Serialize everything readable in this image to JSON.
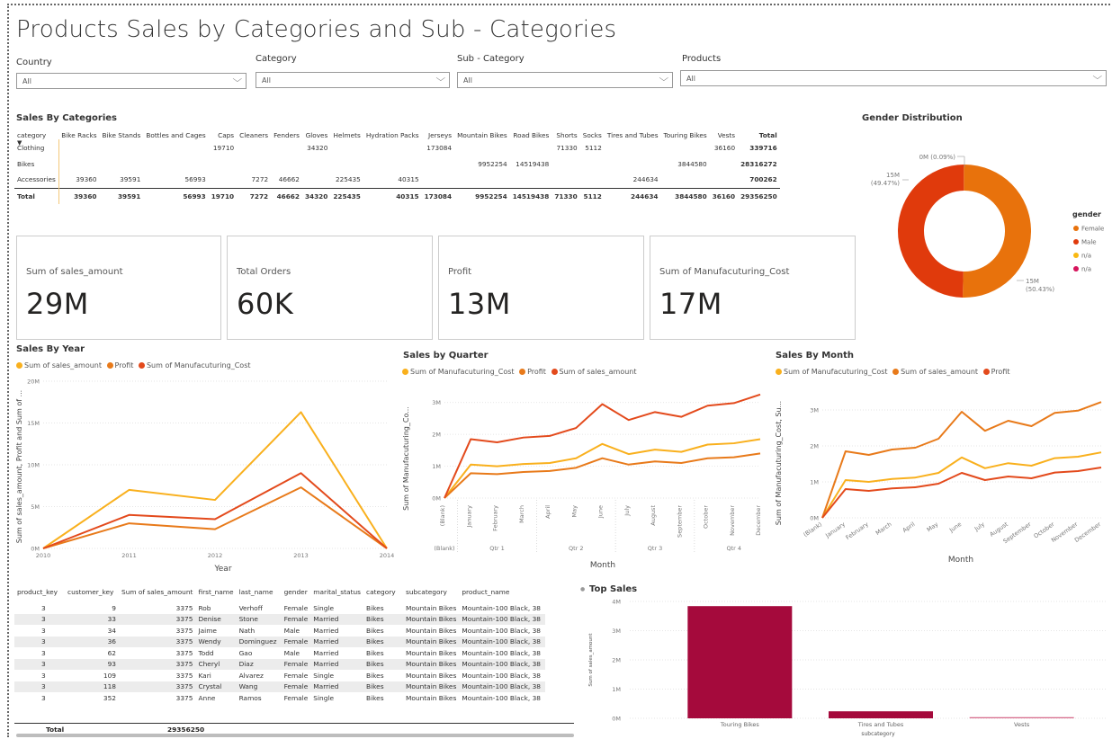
{
  "report_title": "Products Sales by Categories and Sub - Categories",
  "slicers": [
    {
      "label": "Country",
      "value": "All"
    },
    {
      "label": "Category",
      "value": "All"
    },
    {
      "label": "Sub - Category",
      "value": "All"
    },
    {
      "label": "Products",
      "value": "All"
    }
  ],
  "matrix": {
    "title": "Sales By Categories",
    "columns": [
      "category",
      "Bike Racks",
      "Bike Stands",
      "Bottles and Cages",
      "Caps",
      "Cleaners",
      "Fenders",
      "Gloves",
      "Helmets",
      "Hydration Packs",
      "Jerseys",
      "Mountain Bikes",
      "Road Bikes",
      "Shorts",
      "Socks",
      "Tires and Tubes",
      "Touring Bikes",
      "Vests",
      "Total"
    ],
    "rows": [
      [
        "Clothing",
        "",
        "",
        "",
        "19710",
        "",
        "",
        "34320",
        "",
        "",
        "173084",
        "",
        "",
        "71330",
        "5112",
        "",
        "",
        "36160",
        "339716"
      ],
      [
        "Bikes",
        "",
        "",
        "",
        "",
        "",
        "",
        "",
        "",
        "",
        "",
        "9952254",
        "14519438",
        "",
        "",
        "",
        "3844580",
        "",
        "28316272"
      ],
      [
        "Accessories",
        "39360",
        "39591",
        "56993",
        "",
        "7272",
        "46662",
        "",
        "225435",
        "40315",
        "",
        "",
        "",
        "",
        "",
        "244634",
        "",
        "",
        "700262"
      ]
    ],
    "total": [
      "Total",
      "39360",
      "39591",
      "56993",
      "19710",
      "7272",
      "46662",
      "34320",
      "225435",
      "40315",
      "173084",
      "9952254",
      "14519438",
      "71330",
      "5112",
      "244634",
      "3844580",
      "36160",
      "29356250"
    ]
  },
  "kpis": [
    {
      "label": "Sum of sales_amount",
      "value": "29M"
    },
    {
      "label": "Total Orders",
      "value": "60K"
    },
    {
      "label": "Profit",
      "value": "13M"
    },
    {
      "label": "Sum of Manufacuturing_Cost",
      "value": "17M"
    }
  ],
  "gender_chart": {
    "title": "Gender Distribution",
    "legend_title": "gender",
    "outer_labels": {
      "top": "0M (0.09%)",
      "left_value": "15M",
      "left_pct": "(49.47%)",
      "right_value": "15M",
      "right_pct": "(50.43%)"
    },
    "chart_data": {
      "type": "pie",
      "categories": [
        "Female",
        "Male",
        "n/a",
        "n/a"
      ],
      "values": [
        50.43,
        49.47,
        0.09,
        0.01
      ],
      "colors": [
        "#E8720C",
        "#E03A0C",
        "#F9B912",
        "#D6145C"
      ]
    }
  },
  "sales_by_year": {
    "title": "Sales By Year",
    "legend": [
      {
        "name": "Sum of sales_amount",
        "color": "#F9B01D"
      },
      {
        "name": "Profit",
        "color": "#E87A1A"
      },
      {
        "name": "Sum of Manufacuturing_Cost",
        "color": "#E34A1C"
      }
    ],
    "ylabel": "Sum of sales_amount, Profit and Sum of ...",
    "xlabel": "Year",
    "yticks": [
      "0M",
      "5M",
      "10M",
      "15M",
      "20M"
    ],
    "chart_data": {
      "type": "line",
      "x": [
        "2010",
        "2011",
        "2012",
        "2013",
        "2014"
      ],
      "ylim": [
        0,
        20
      ],
      "series": [
        {
          "name": "Sum of sales_amount",
          "values": [
            0,
            7.0,
            5.8,
            16.3,
            0
          ]
        },
        {
          "name": "Profit",
          "values": [
            0,
            3.0,
            2.3,
            7.3,
            0
          ]
        },
        {
          "name": "Sum of Manufacuturing_Cost",
          "values": [
            0,
            4.0,
            3.5,
            9.0,
            0
          ]
        }
      ]
    }
  },
  "sales_by_quarter": {
    "title": "Sales by Quarter",
    "legend": [
      {
        "name": "Sum of Manufacuturing_Cost",
        "color": "#F9B01D"
      },
      {
        "name": "Profit",
        "color": "#E87A1A"
      },
      {
        "name": "Sum of sales_amount",
        "color": "#E34A1C"
      }
    ],
    "ylabel": "Sum of Manufacuturing_Co...",
    "xlabel": "Month",
    "yticks": [
      "0M",
      "1M",
      "2M",
      "3M"
    ],
    "groups": [
      "(Blank)",
      "Qtr 1",
      "Qtr 2",
      "Qtr 3",
      "Qtr 4"
    ],
    "chart_data": {
      "type": "line",
      "x": [
        "(Blank)",
        "January",
        "February",
        "March",
        "April",
        "May",
        "June",
        "July",
        "August",
        "September",
        "October",
        "November",
        "December"
      ],
      "ylim": [
        0,
        3.5
      ],
      "series": [
        {
          "name": "Sum of Manufacuturing_Cost",
          "values": [
            0,
            1.05,
            1.0,
            1.07,
            1.1,
            1.25,
            1.7,
            1.38,
            1.52,
            1.45,
            1.68,
            1.72,
            1.85
          ]
        },
        {
          "name": "Profit",
          "values": [
            0,
            0.78,
            0.75,
            0.82,
            0.85,
            0.95,
            1.25,
            1.05,
            1.15,
            1.1,
            1.25,
            1.28,
            1.4
          ]
        },
        {
          "name": "Sum of sales_amount",
          "values": [
            0,
            1.85,
            1.75,
            1.9,
            1.95,
            2.2,
            2.95,
            2.45,
            2.7,
            2.55,
            2.9,
            2.98,
            3.25
          ]
        }
      ]
    }
  },
  "sales_by_month": {
    "title": "Sales By Month",
    "legend": [
      {
        "name": "Sum of Manufacuturing_Cost",
        "color": "#F9B01D"
      },
      {
        "name": "Sum of sales_amount",
        "color": "#E87A1A"
      },
      {
        "name": "Profit",
        "color": "#E34A1C"
      }
    ],
    "ylabel": "Sum of Manufacuturing_Cost, Su...",
    "xlabel": "Month",
    "yticks": [
      "0M",
      "1M",
      "2M",
      "3M"
    ],
    "chart_data": {
      "type": "line",
      "x": [
        "(Blank)",
        "January",
        "February",
        "March",
        "April",
        "May",
        "June",
        "July",
        "August",
        "September",
        "October",
        "November",
        "December"
      ],
      "ylim": [
        0,
        3.5
      ],
      "series": [
        {
          "name": "Sum of Manufacuturing_Cost",
          "values": [
            0,
            1.05,
            1.0,
            1.08,
            1.12,
            1.25,
            1.68,
            1.38,
            1.52,
            1.45,
            1.66,
            1.7,
            1.82
          ]
        },
        {
          "name": "Sum of sales_amount",
          "values": [
            0,
            1.85,
            1.75,
            1.9,
            1.95,
            2.2,
            2.95,
            2.42,
            2.7,
            2.55,
            2.92,
            2.98,
            3.22
          ]
        },
        {
          "name": "Profit",
          "values": [
            0,
            0.8,
            0.75,
            0.82,
            0.85,
            0.95,
            1.25,
            1.05,
            1.15,
            1.1,
            1.26,
            1.3,
            1.4
          ]
        }
      ]
    }
  },
  "detail_table": {
    "columns": [
      "product_key",
      "customer_key",
      "Sum of sales_amount",
      "first_name",
      "last_name",
      "gender",
      "marital_status",
      "category",
      "subcategory",
      "product_name"
    ],
    "rows": [
      [
        "3",
        "9",
        "3375",
        "Rob",
        "Verhoff",
        "Female",
        "Single",
        "Bikes",
        "Mountain Bikes",
        "Mountain-100 Black, 38"
      ],
      [
        "3",
        "33",
        "3375",
        "Denise",
        "Stone",
        "Female",
        "Married",
        "Bikes",
        "Mountain Bikes",
        "Mountain-100 Black, 38"
      ],
      [
        "3",
        "34",
        "3375",
        "Jaime",
        "Nath",
        "Male",
        "Married",
        "Bikes",
        "Mountain Bikes",
        "Mountain-100 Black, 38"
      ],
      [
        "3",
        "36",
        "3375",
        "Wendy",
        "Dominguez",
        "Female",
        "Married",
        "Bikes",
        "Mountain Bikes",
        "Mountain-100 Black, 38"
      ],
      [
        "3",
        "62",
        "3375",
        "Todd",
        "Gao",
        "Male",
        "Married",
        "Bikes",
        "Mountain Bikes",
        "Mountain-100 Black, 38"
      ],
      [
        "3",
        "93",
        "3375",
        "Cheryl",
        "Diaz",
        "Female",
        "Married",
        "Bikes",
        "Mountain Bikes",
        "Mountain-100 Black, 38"
      ],
      [
        "3",
        "109",
        "3375",
        "Kari",
        "Alvarez",
        "Female",
        "Single",
        "Bikes",
        "Mountain Bikes",
        "Mountain-100 Black, 38"
      ],
      [
        "3",
        "118",
        "3375",
        "Crystal",
        "Wang",
        "Female",
        "Married",
        "Bikes",
        "Mountain Bikes",
        "Mountain-100 Black, 38"
      ],
      [
        "3",
        "352",
        "3375",
        "Anne",
        "Ramos",
        "Female",
        "Single",
        "Bikes",
        "Mountain Bikes",
        "Mountain-100 Black, 38"
      ]
    ],
    "total_label": "Total",
    "total_value": "29356250"
  },
  "top_sales": {
    "title": "Top Sales",
    "ylabel": "Sum of sales_amount",
    "xlabel": "subcategory",
    "yticks": [
      "0M",
      "1M",
      "2M",
      "3M",
      "4M"
    ],
    "chart_data": {
      "type": "bar",
      "categories": [
        "Touring Bikes",
        "Tires and Tubes",
        "Vests"
      ],
      "values": [
        3.84,
        0.24,
        0.04
      ],
      "ylim": [
        0,
        4
      ],
      "colors": [
        "#A50A3C",
        "#A50A3C",
        "#D66C8C"
      ]
    }
  }
}
